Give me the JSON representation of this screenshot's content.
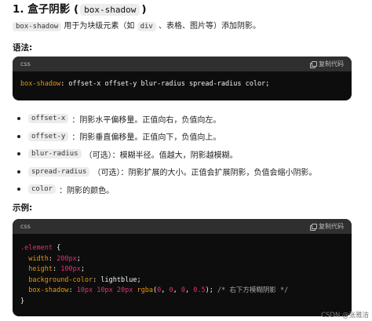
{
  "heading": {
    "number": "1.",
    "title": "盒子阴影",
    "open": "(",
    "code": "box-shadow",
    "close": ")"
  },
  "intro": {
    "code": "box-shadow",
    "text1": "用于为块级元素（如",
    "code2": "div",
    "text2": "、表格、图片等）添加阴影。"
  },
  "syntax_label": "语法:",
  "syntax_block": {
    "lang": "css",
    "copy_label": "复制代码",
    "prop": "box-shadow",
    "rest": ": offset-x offset-y blur-radius spread-radius color;"
  },
  "params": [
    {
      "code": "offset-x",
      "text": "：阴影水平偏移量。正值向右，负值向左。"
    },
    {
      "code": "offset-y",
      "text": "：阴影垂直偏移量。正值向下，负值向上。"
    },
    {
      "code": "blur-radius",
      "text": "（可选）：模糊半径。值越大，阴影越模糊。"
    },
    {
      "code": "spread-radius",
      "text": "（可选）：阴影扩展的大小。正值会扩展阴影，负值会缩小阴影。"
    },
    {
      "code": "color",
      "text": "：阴影的颜色。"
    }
  ],
  "example_label": "示例:",
  "example_block": {
    "lang": "css",
    "copy_label": "复制代码",
    "selector": ".element",
    "open_brace": " {",
    "width_prop": "width",
    "width_val": "200px",
    "height_prop": "height",
    "height_val": "100px",
    "bg_prop": "background-color",
    "bg_val": "lightblue",
    "shadow_prop": "box-shadow",
    "shadow_n1": "10px",
    "shadow_n2": "10px",
    "shadow_n3": "20px",
    "shadow_func": "rgba",
    "shadow_a": "0",
    "shadow_b": "0",
    "shadow_c": "0",
    "shadow_d": "0.5",
    "comment": "/* 右下方模糊阴影 */",
    "close_brace": "}"
  },
  "watermark": "CSDN @张雅洁"
}
